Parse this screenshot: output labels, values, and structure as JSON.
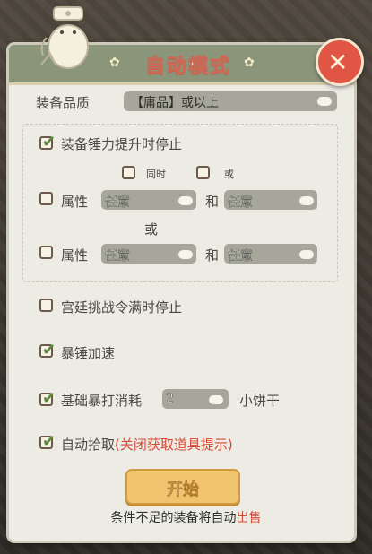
{
  "title": "自动模式",
  "quality": {
    "label": "装备品质",
    "value": "【庸品】或以上"
  },
  "stop_on_power": {
    "label": "装备锤力提升时停止",
    "checked": true
  },
  "logic": {
    "and_label": "同时",
    "or_label": "或",
    "and_checked": false,
    "or_checked": false
  },
  "attr_rows": [
    {
      "label": "属性",
      "left": "任意",
      "joiner": "和",
      "right": "任意",
      "checked": false
    },
    {
      "label": "属性",
      "left": "任意",
      "joiner": "和",
      "right": "任意",
      "checked": false
    }
  ],
  "between_rows_or": "或",
  "court_stop": {
    "label": "宫廷挑战令满时停止",
    "checked": false
  },
  "speed_up": {
    "label": "暴锤加速",
    "checked": true
  },
  "consume": {
    "label": "基础暴打消耗",
    "value": "2",
    "unit": "小饼干",
    "checked": true
  },
  "auto_pickup": {
    "label_prefix": "自动拾取",
    "label_red": "(关闭获取道具提示)",
    "checked": true
  },
  "start_button": "开始",
  "footer": {
    "prefix": "条件不足的装备将自动",
    "red": "出售"
  },
  "colors": {
    "header": "#8a957a",
    "panel": "#ecebe4",
    "close": "#e05543",
    "start": "#f0c46e",
    "accent_red": "#d64a36"
  }
}
